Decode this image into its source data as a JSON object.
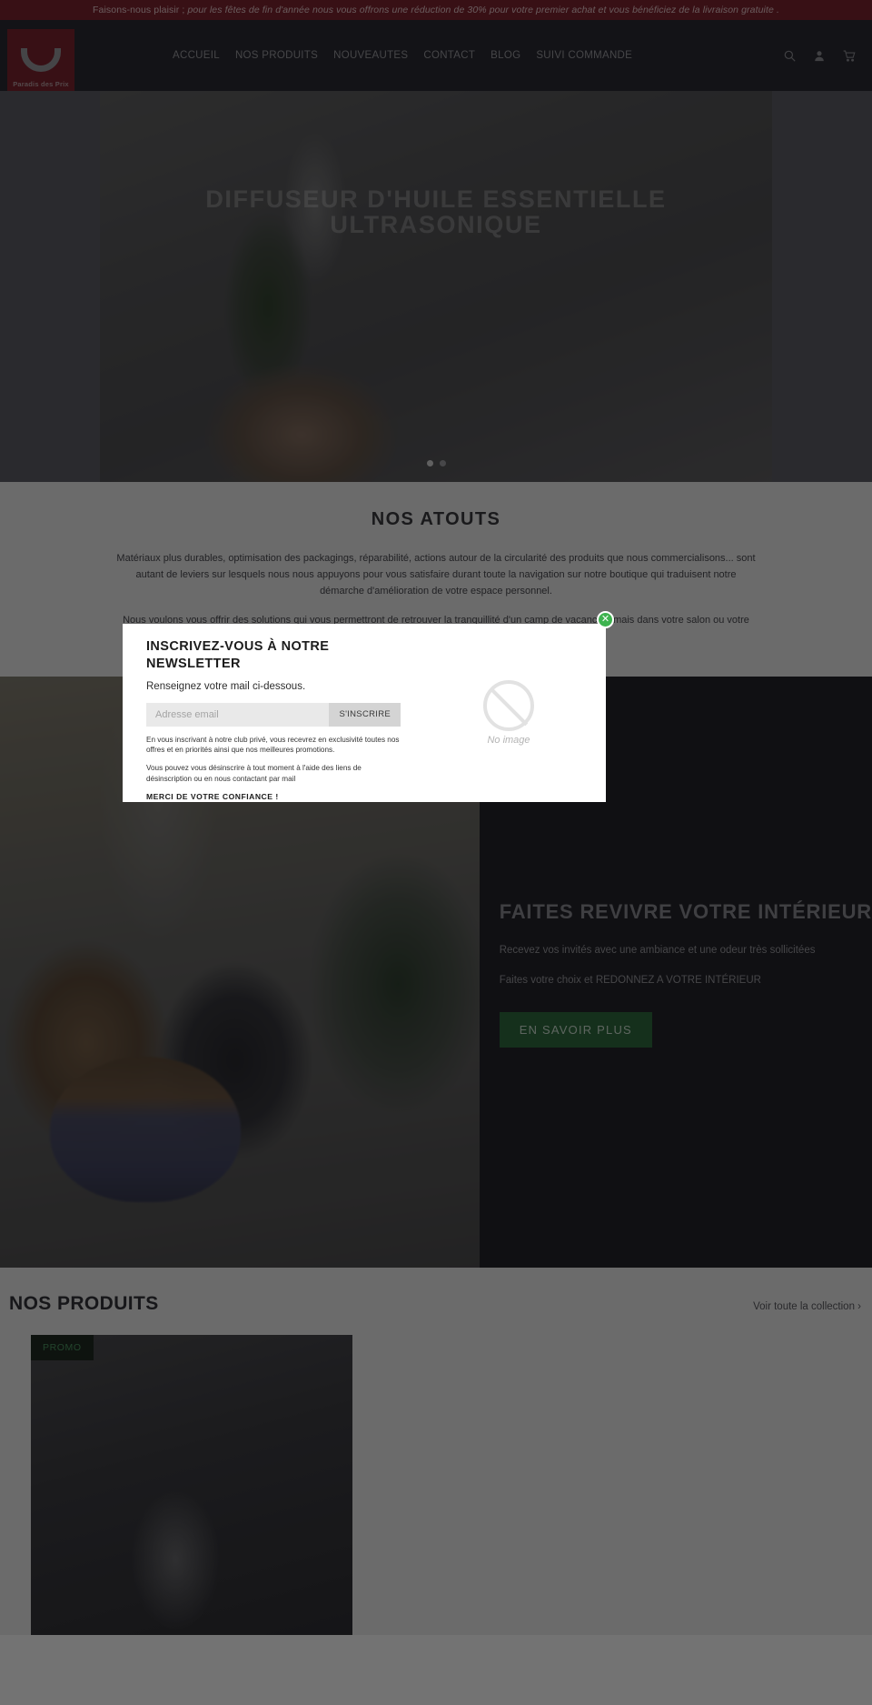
{
  "announcement": {
    "lead": "Faisons-nous plaisir ;",
    "italic": " pour les fêtes de fin d'année nous vous offrons une réduction de 30% pour votre premier achat et vous bénéficiez de la livraison gratuite ."
  },
  "header": {
    "logo_text": "Paradis des Prix",
    "nav": [
      {
        "label": "ACCUEIL"
      },
      {
        "label": "NOS PRODUITS"
      },
      {
        "label": "NOUVEAUTES"
      },
      {
        "label": "CONTACT"
      },
      {
        "label": "BLOG"
      },
      {
        "label": "SUIVI COMMANDE"
      }
    ],
    "icons": [
      "search-icon",
      "account-icon",
      "cart-icon"
    ]
  },
  "hero": {
    "title": "DIFFUSEUR D'HUILE ESSENTIELLE ULTRASONIQUE",
    "slide_count": 2,
    "active_slide": 1
  },
  "atouts": {
    "title": "NOS ATOUTS",
    "paragraph_1": "Matériaux plus durables, optimisation des packagings, réparabilité, actions autour de la circularité des produits que nous commercialisons... sont autant de leviers sur lesquels nous nous appuyons pour vous satisfaire durant toute la navigation sur notre boutique qui traduisent notre démarche d'amélioration de votre espace personnel.",
    "paragraph_2": "Nous voulons vous offrir des solutions qui vous permettront de retrouver la tranquillité d'un camp de vacances, mais dans votre salon ou votre chambre."
  },
  "feature": {
    "title": "FAITES REVIVRE VOTRE INTÉRIEUR",
    "paragraph_1": "Recevez vos invités avec une ambiance et une odeur très sollicitées",
    "paragraph_2": "Faites votre choix et REDONNEZ A VOTRE INTÉRIEUR",
    "button_label": "EN SAVOIR PLUS"
  },
  "products": {
    "title": "NOS PRODUITS",
    "see_all_label": "Voir toute la collection ›",
    "cards": [
      {
        "badge": "PROMO"
      }
    ]
  },
  "newsletter_modal": {
    "title": "INSCRIVEZ-VOUS À NOTRE NEWSLETTER",
    "subtitle": "Renseignez votre mail ci-dessous.",
    "email_placeholder": "Adresse email",
    "email_value": "",
    "submit_label": "S'INSCRIRE",
    "fine_print_1": "En vous inscrivant à notre club privé, vous recevrez en exclusivité toutes nos offres et en priorités ainsi que nos meilleures promotions.",
    "fine_print_2": "Vous pouvez vous désinscrire à tout moment à l'aide des liens de désinscription ou en nous contactant par mail",
    "thanks": "MERCI DE VOTRE CONFIANCE !",
    "no_image_label": "No image",
    "close_label": "✕"
  },
  "colors": {
    "announcement_bg": "#7d2430",
    "header_bg": "#2b2b33",
    "brand_red": "#7d2430",
    "accent_green": "#2f6b3e",
    "close_green": "#3eb34f",
    "promo_green": "#4f9a63",
    "dark_panel": "#24242b",
    "section_bg": "#ededed"
  }
}
